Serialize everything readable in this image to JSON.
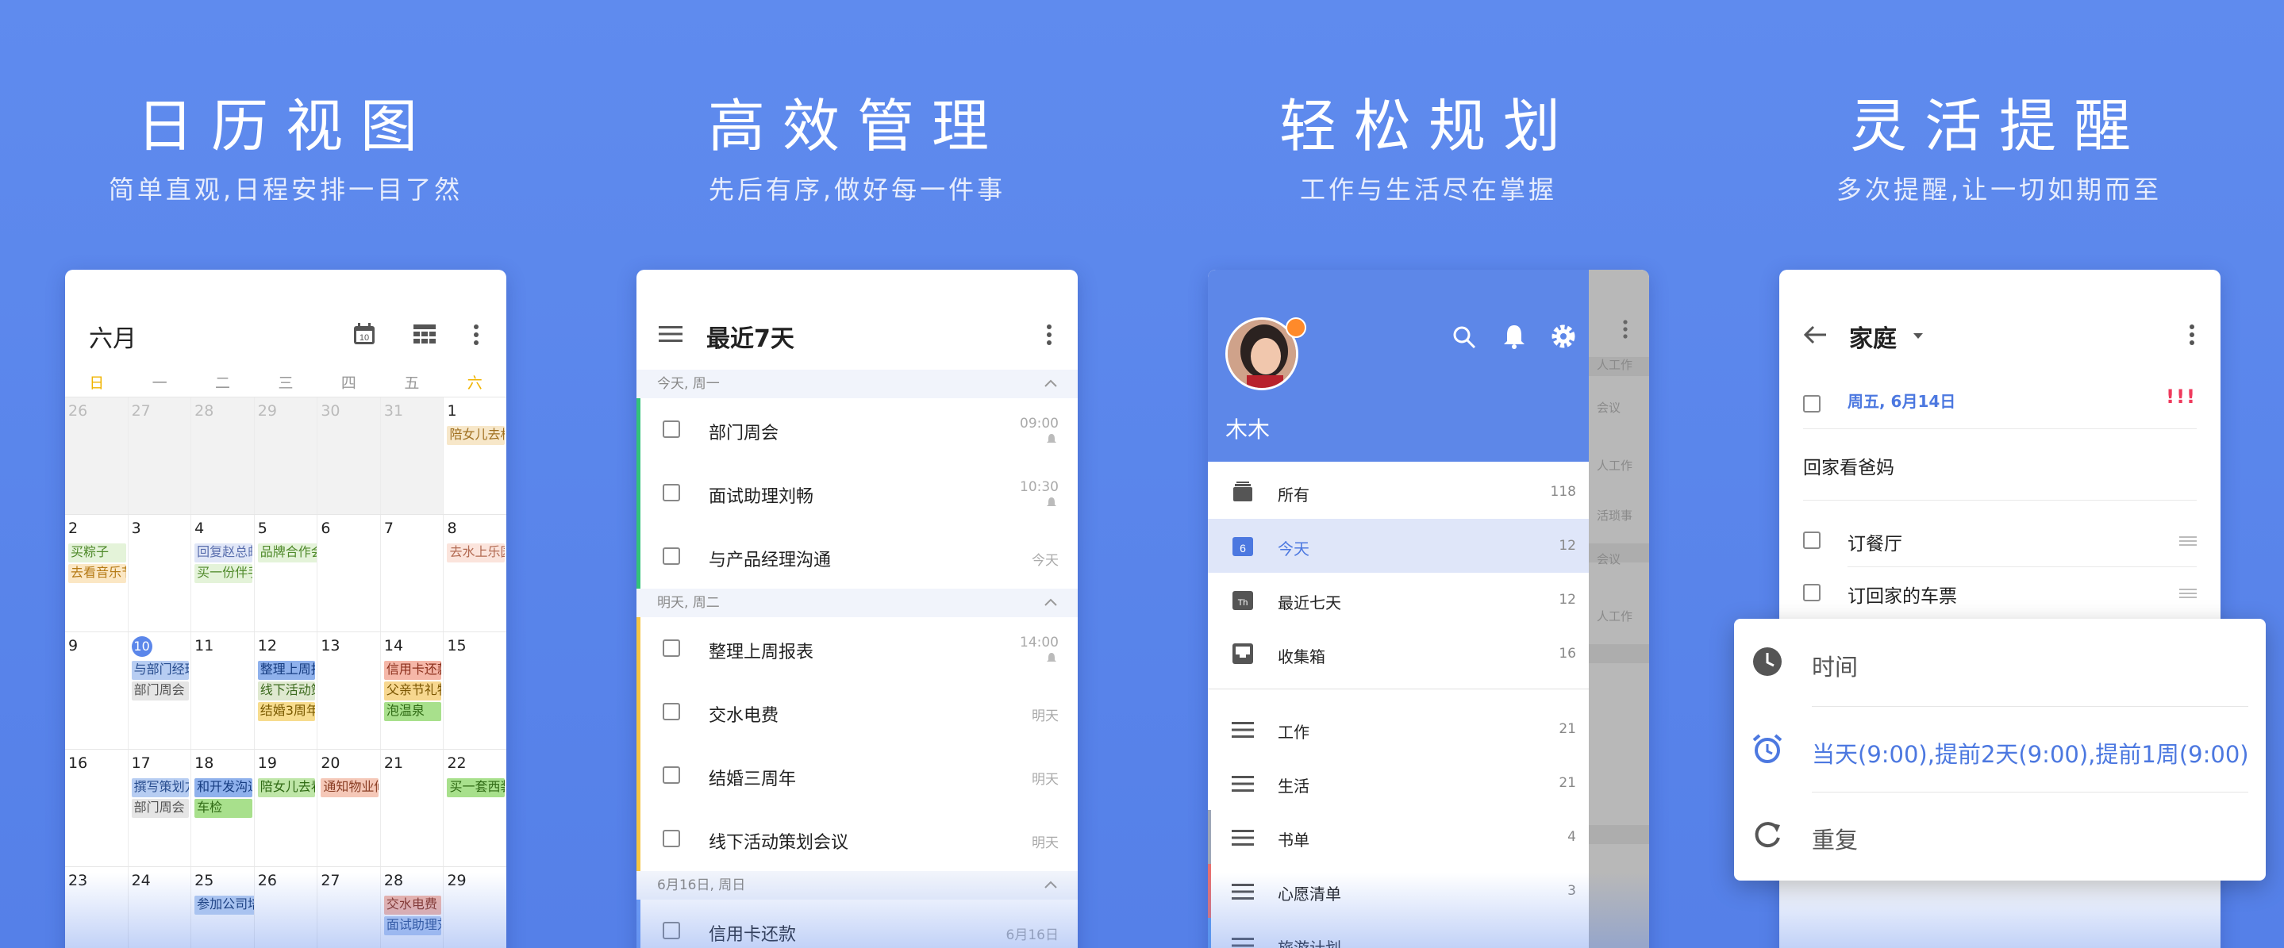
{
  "panels": {
    "p1": {
      "title": "日历视图",
      "subtitle": "简单直观,日程安排一目了然"
    },
    "p2": {
      "title": "高效管理",
      "subtitle": "先后有序,做好每一件事"
    },
    "p3": {
      "title": "轻松规划",
      "subtitle": "工作与生活尽在掌握"
    },
    "p4": {
      "title": "灵活提醒",
      "subtitle": "多次提醒,让一切如期而至"
    }
  },
  "calendar": {
    "month": "六月",
    "today_badge": "10",
    "weekdays": [
      "日",
      "一",
      "二",
      "三",
      "四",
      "五",
      "六"
    ],
    "rows": [
      [
        {
          "d": "26",
          "dim": true
        },
        {
          "d": "27",
          "dim": true
        },
        {
          "d": "28",
          "dim": true
        },
        {
          "d": "29",
          "dim": true
        },
        {
          "d": "30",
          "dim": true
        },
        {
          "d": "31",
          "dim": true
        },
        {
          "d": "1",
          "ev": [
            {
              "t": "陪女儿去机",
              "c": "#f7e7c9",
              "f": "#a07020"
            }
          ]
        }
      ],
      [
        {
          "d": "2",
          "ev": [
            {
              "t": "买粽子",
              "c": "#e4f3d9",
              "f": "#4f8a2a"
            },
            {
              "t": "去看音乐节",
              "c": "#fbe7c4",
              "f": "#b57a15"
            }
          ]
        },
        {
          "d": "3"
        },
        {
          "d": "4",
          "ev": [
            {
              "t": "回复赵总邮",
              "c": "#e0e6f7",
              "f": "#5a6fae"
            },
            {
              "t": "买一份伴手",
              "c": "#e4f3d9",
              "f": "#4f8a2a"
            }
          ]
        },
        {
          "d": "5",
          "ev": [
            {
              "t": "品牌合作会议",
              "c": "#e4f3d9",
              "f": "#4f8a2a",
              "span": true
            }
          ]
        },
        {
          "d": "6"
        },
        {
          "d": "7"
        },
        {
          "d": "8",
          "ev": [
            {
              "t": "去水上乐园",
              "c": "#fbe4dc",
              "f": "#b26a52"
            }
          ]
        }
      ],
      [
        {
          "d": "9"
        },
        {
          "d": "10",
          "today": true,
          "ev": [
            {
              "t": "与部门经理",
              "c": "#b7cdf2",
              "f": "#284d8f"
            },
            {
              "t": "部门周会",
              "c": "#e5e5e5",
              "f": "#555"
            }
          ]
        },
        {
          "d": "11"
        },
        {
          "d": "12",
          "ev": [
            {
              "t": "整理上周报",
              "c": "#8fb1ec",
              "f": "#163c80"
            },
            {
              "t": "线下活动策",
              "c": "#dfe9d0",
              "f": "#3c6a1e"
            },
            {
              "t": "结婚3周年",
              "c": "#f7dc8e",
              "f": "#7a5a00"
            }
          ]
        },
        {
          "d": "13"
        },
        {
          "d": "14",
          "ev": [
            {
              "t": "信用卡还款",
              "c": "#f5b7a8",
              "f": "#8a2e1a"
            },
            {
              "t": "父亲节礼物",
              "c": "#f7d78f",
              "f": "#7a5500"
            },
            {
              "t": "泡温泉",
              "c": "#a8e08c",
              "f": "#2f6a14"
            }
          ]
        },
        {
          "d": "15"
        }
      ],
      [
        {
          "d": "16"
        },
        {
          "d": "17",
          "ev": [
            {
              "t": "撰写策划方",
              "c": "#b7cdf2",
              "f": "#284d8f"
            },
            {
              "t": "部门周会",
              "c": "#e5e5e5",
              "f": "#555"
            }
          ]
        },
        {
          "d": "18",
          "ev": [
            {
              "t": "和开发沟通",
              "c": "#8fb1ec",
              "f": "#163c80"
            },
            {
              "t": "车检",
              "c": "#a8e08c",
              "f": "#2f6a14"
            }
          ]
        },
        {
          "d": "19",
          "ev": [
            {
              "t": "陪女儿去看",
              "c": "#bfe6a8",
              "f": "#2f6a14"
            }
          ]
        },
        {
          "d": "20",
          "ev": [
            {
              "t": "通知物业修",
              "c": "#f5c8b8",
              "f": "#8a3e24"
            }
          ]
        },
        {
          "d": "21"
        },
        {
          "d": "22",
          "ev": [
            {
              "t": "买一套西装",
              "c": "#a8e08c",
              "f": "#2f6a14"
            }
          ]
        }
      ],
      [
        {
          "d": "23"
        },
        {
          "d": "24"
        },
        {
          "d": "25",
          "ev": [
            {
              "t": "参加公司培训",
              "c": "#a9c3f0",
              "f": "#1f4384",
              "span": true
            }
          ]
        },
        {
          "d": "26"
        },
        {
          "d": "27"
        },
        {
          "d": "28",
          "ev": [
            {
              "t": "交水电费",
              "c": "#f5b7a8",
              "f": "#8a2e1a"
            },
            {
              "t": "面试助理刘",
              "c": "#b7cdf2",
              "f": "#284d8f"
            }
          ]
        },
        {
          "d": "29"
        }
      ]
    ]
  },
  "tasks": {
    "title": "最近7天",
    "sections": [
      {
        "label": "今天, 周一",
        "items": [
          {
            "text": "部门周会",
            "time": "09:00",
            "bell": true,
            "color": "#34c27a"
          },
          {
            "text": "面试助理刘畅",
            "time": "10:30",
            "bell": true,
            "color": "#34c27a"
          },
          {
            "text": "与产品经理沟通",
            "time": "今天",
            "bell": false,
            "color": "#34c27a"
          }
        ]
      },
      {
        "label": "明天, 周二",
        "items": [
          {
            "text": "整理上周报表",
            "time": "14:00",
            "bell": true,
            "color": "#f5c543"
          },
          {
            "text": "交水电费",
            "time": "明天",
            "bell": false,
            "color": "#f5c543"
          },
          {
            "text": "结婚三周年",
            "time": "明天",
            "bell": false,
            "color": "#f5c543"
          },
          {
            "text": "线下活动策划会议",
            "time": "明天",
            "bell": false,
            "color": "#f5c543"
          }
        ]
      },
      {
        "label": "6月16日, 周日",
        "items": [
          {
            "text": "信用卡还款",
            "time": "6月16日",
            "bell": false,
            "color": "#6d9cf5"
          }
        ]
      }
    ]
  },
  "drawer": {
    "user": "木木",
    "smart": [
      {
        "label": "所有",
        "count": "118",
        "icon": "inbox-stack-icon"
      },
      {
        "label": "今天",
        "count": "12",
        "icon": "calendar-today-icon",
        "selected": true,
        "badge": "6"
      },
      {
        "label": "最近七天",
        "count": "12",
        "icon": "calendar-week-icon",
        "badge": "Th"
      },
      {
        "label": "收集箱",
        "count": "16",
        "icon": "inbox-icon"
      }
    ],
    "lists": [
      {
        "label": "工作",
        "count": "21",
        "bar": ""
      },
      {
        "label": "生活",
        "count": "21",
        "bar": ""
      },
      {
        "label": "书单",
        "count": "4",
        "bar": "#9ea7b8"
      },
      {
        "label": "心愿清单",
        "count": "3",
        "bar": "#e77070"
      },
      {
        "label": "旅游计划",
        "count": "",
        "bar": "#5b9cf0"
      }
    ],
    "ghost": [
      "人工作",
      "会议",
      "人工作",
      "活琐事",
      "会议",
      "人工作"
    ]
  },
  "reminder": {
    "list": "家庭",
    "date": "周五, 6月14日",
    "priority": "!!!",
    "note": "回家看爸妈",
    "subtasks": [
      "订餐厅",
      "订回家的车票"
    ],
    "popup": [
      {
        "label": "时间",
        "blue": false,
        "icon": "clock-icon"
      },
      {
        "label": "当天(9:00),提前2天(9:00),提前1周(9:00)",
        "blue": true,
        "icon": "alarm-clock-icon"
      },
      {
        "label": "重复",
        "blue": false,
        "icon": "repeat-icon"
      }
    ]
  }
}
